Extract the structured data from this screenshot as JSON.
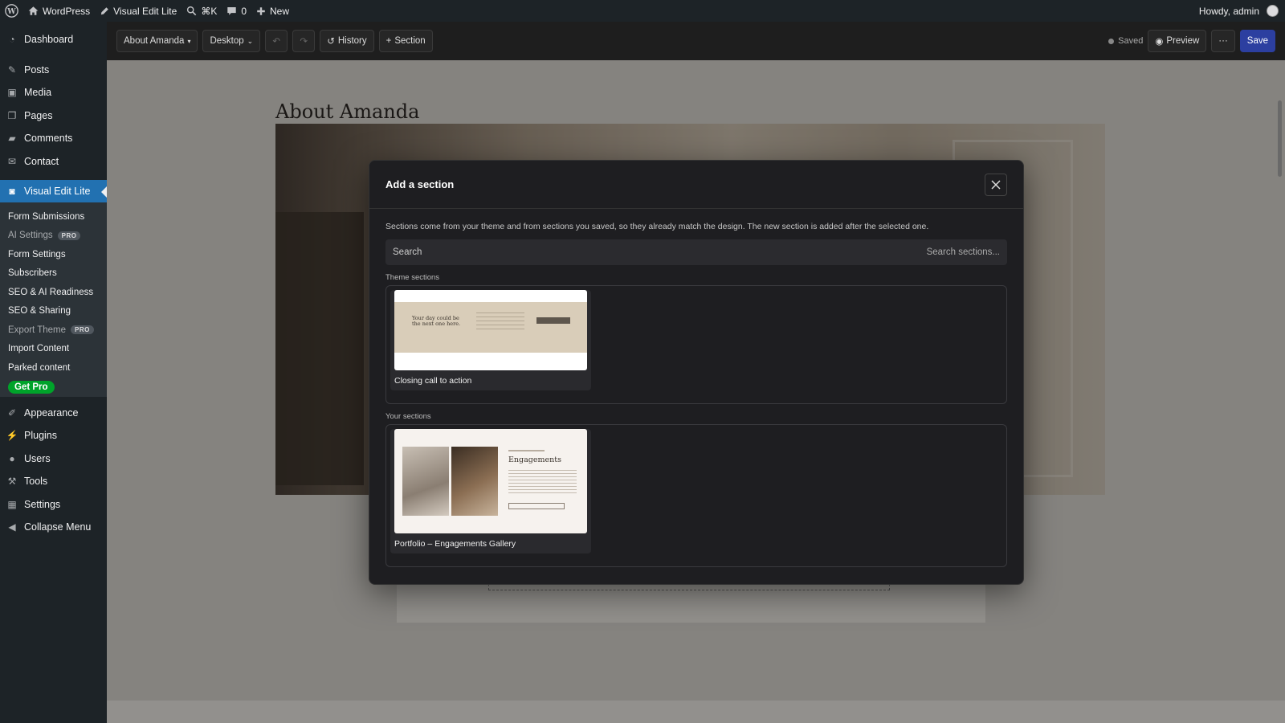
{
  "admin_bar": {
    "site_name": "WordPress",
    "plugin_link": "Visual Edit Lite",
    "shortcut": "⌘K",
    "comments_count": "0",
    "new_label": "New",
    "greeting": "Howdy, admin"
  },
  "sidebar": {
    "top_items": [
      {
        "label": "Dashboard",
        "icon": "dashboard-icon"
      },
      {
        "label": "Posts",
        "icon": "pin-icon"
      },
      {
        "label": "Media",
        "icon": "media-icon"
      },
      {
        "label": "Pages",
        "icon": "pages-icon"
      },
      {
        "label": "Comments",
        "icon": "comment-icon"
      },
      {
        "label": "Contact",
        "icon": "mail-icon"
      }
    ],
    "active_item": "Visual Edit Lite",
    "submenu": [
      {
        "label": "Form Submissions"
      },
      {
        "label": "AI Settings",
        "badge": "PRO"
      },
      {
        "label": "Form Settings"
      },
      {
        "label": "Subscribers"
      },
      {
        "label": "SEO & AI Readiness"
      },
      {
        "label": "SEO & Sharing"
      },
      {
        "label": "Export Theme",
        "badge": "PRO"
      },
      {
        "label": "Import Content"
      },
      {
        "label": "Parked content"
      }
    ],
    "get_pro": "Get Pro",
    "bottom_items": [
      {
        "label": "Appearance",
        "icon": "brush-icon"
      },
      {
        "label": "Plugins",
        "icon": "plugin-icon"
      },
      {
        "label": "Users",
        "icon": "user-icon"
      },
      {
        "label": "Tools",
        "icon": "wrench-icon"
      },
      {
        "label": "Settings",
        "icon": "settings-icon"
      },
      {
        "label": "Collapse Menu",
        "icon": "collapse-icon"
      }
    ]
  },
  "toolbar": {
    "page_select": "About Amanda",
    "device_select": "Desktop",
    "history_label": "History",
    "section_label": "Section",
    "saved_label": "Saved",
    "preview_label": "Preview",
    "more_label": "···",
    "save_label": "Save"
  },
  "page": {
    "title": "About Amanda"
  },
  "modal": {
    "title": "Add a section",
    "description": "Sections come from your theme and from sections you saved, so they already match the design. The new section is added after the selected one.",
    "search_label": "Search",
    "search_placeholder": "Search sections...",
    "theme_group_label": "Theme sections",
    "theme_sections": [
      {
        "name": "Closing call to action",
        "preview_heading": "Your day could be the next one here."
      }
    ],
    "your_group_label": "Your sections",
    "your_sections": [
      {
        "name": "Portfolio – Engagements Gallery",
        "preview_heading": "Engagements"
      }
    ]
  }
}
